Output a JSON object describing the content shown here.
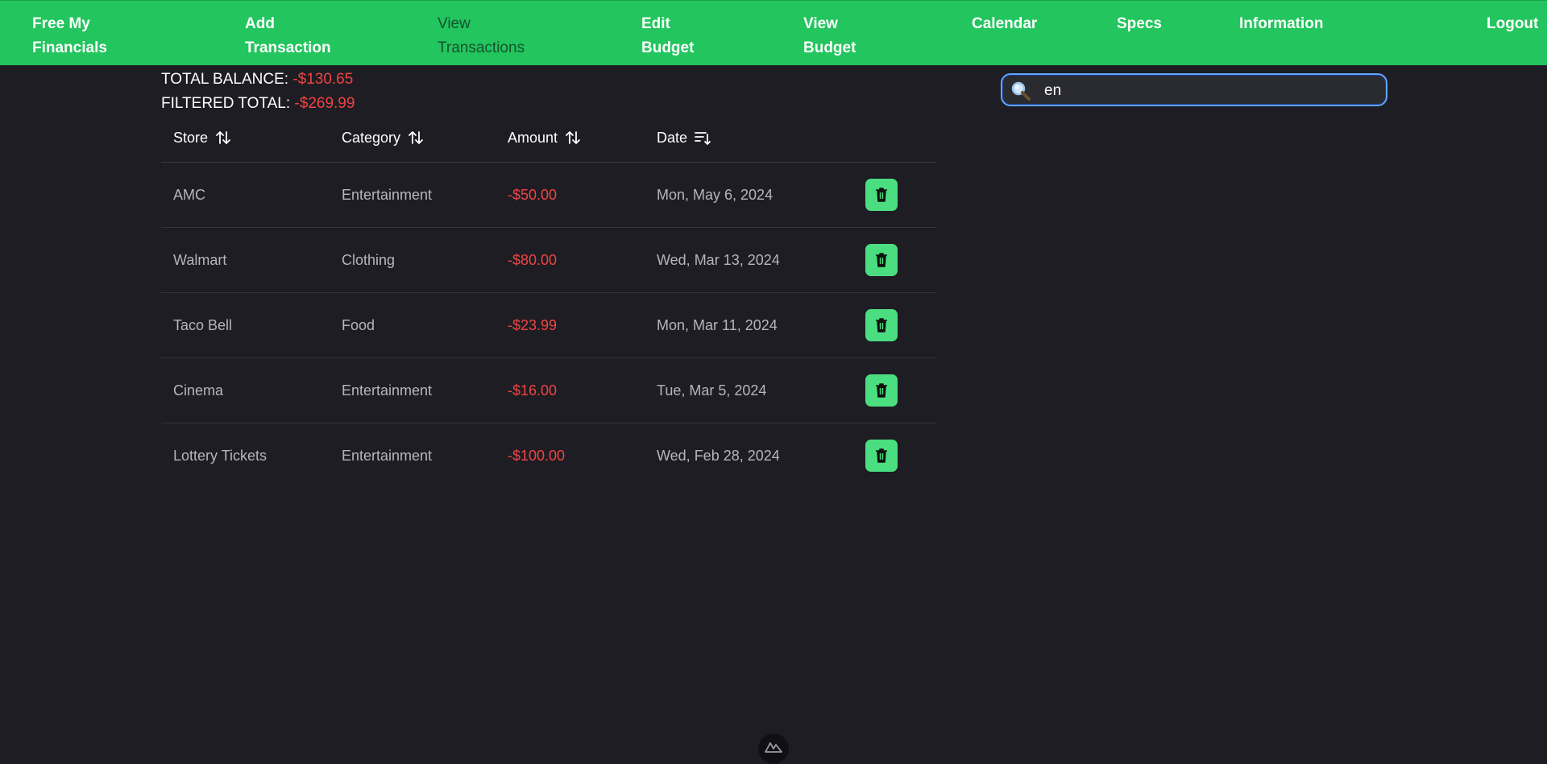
{
  "nav": {
    "brand": "Free My\nFinancials",
    "items": [
      {
        "label": "Add\nTransaction"
      },
      {
        "label": "View\nTransactions"
      },
      {
        "label": "Edit\nBudget"
      },
      {
        "label": "View\nBudget"
      },
      {
        "label": "Calendar"
      },
      {
        "label": "Specs"
      },
      {
        "label": "Information"
      }
    ],
    "logout": "Logout"
  },
  "summary": {
    "total_label": "TOTAL BALANCE:",
    "total_value": "-$130.65",
    "filtered_label": "FILTERED TOTAL:",
    "filtered_value": "-$269.99"
  },
  "search": {
    "value": "en",
    "icon": "magnifying-glass"
  },
  "table": {
    "columns": [
      "Store",
      "Category",
      "Amount",
      "Date"
    ],
    "rows": [
      {
        "store": "AMC",
        "category": "Entertainment",
        "amount": "-$50.00",
        "date": "Mon, May 6, 2024"
      },
      {
        "store": "Walmart",
        "category": "Clothing",
        "amount": "-$80.00",
        "date": "Wed, Mar 13, 2024"
      },
      {
        "store": "Taco Bell",
        "category": "Food",
        "amount": "-$23.99",
        "date": "Mon, Mar 11, 2024"
      },
      {
        "store": "Cinema",
        "category": "Entertainment",
        "amount": "-$16.00",
        "date": "Tue, Mar 5, 2024"
      },
      {
        "store": "Lottery Tickets",
        "category": "Entertainment",
        "amount": "-$100.00",
        "date": "Wed, Feb 28, 2024"
      }
    ]
  },
  "colors": {
    "nav_bg": "#22c55e",
    "page_bg": "#1d1d23",
    "negative": "#ef4444",
    "delete_button": "#4ade80",
    "search_border": "#60a5fa"
  }
}
